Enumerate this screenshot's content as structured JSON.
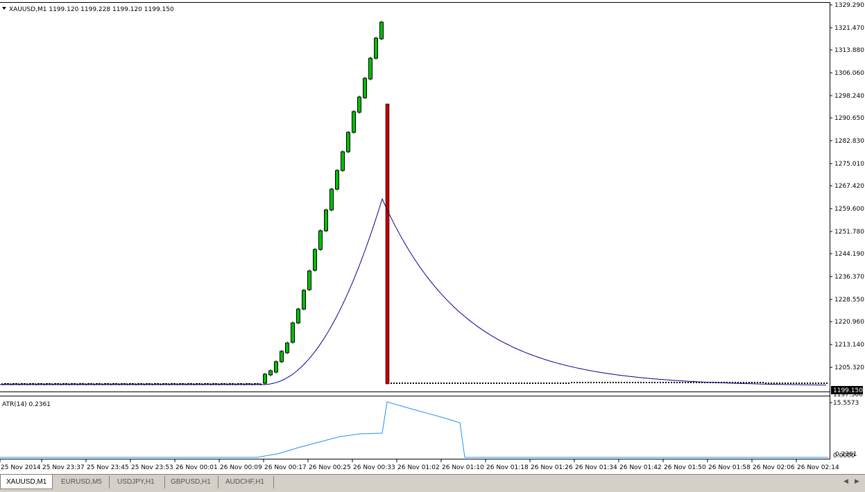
{
  "main_chart": {
    "symbol_title": "XAUUSD,M1  1199.120 1199.228 1199.120 1199.150",
    "current_price_label": "1199.150",
    "hidden_label": "1197.500",
    "price_ticks": [
      "1329.290",
      "1321.470",
      "1313.880",
      "1306.060",
      "1298.240",
      "1290.650",
      "1282.830",
      "1275.010",
      "1267.420",
      "1259.600",
      "1251.780",
      "1244.190",
      "1236.370",
      "1228.550",
      "1220.960",
      "1213.140",
      "1205.320"
    ],
    "colors": {
      "bull_candle": "#00c000",
      "bear_bar": "#c00000",
      "indicator_line": "#00008b",
      "atr_line": "#1e90ff"
    }
  },
  "indicator": {
    "title": "ATR(14) 0.2361",
    "ticks": [
      "15.5573",
      "0.0000",
      "0.2361"
    ]
  },
  "time_axis": {
    "labels": [
      "25 Nov 2014",
      "25 Nov 23:37",
      "25 Nov 23:45",
      "25 Nov 23:53",
      "26 Nov 00:01",
      "26 Nov 00:09",
      "26 Nov 00:17",
      "26 Nov 00:25",
      "26 Nov 00:33",
      "26 Nov 01:02",
      "26 Nov 01:10",
      "26 Nov 01:18",
      "26 Nov 01:26",
      "26 Nov 01:34",
      "26 Nov 01:42",
      "26 Nov 01:50",
      "26 Nov 01:58",
      "26 Nov 02:06",
      "26 Nov 02:14"
    ]
  },
  "tabs": [
    {
      "label": "XAUUSD,M1",
      "active": true
    },
    {
      "label": "EURUSD,M5",
      "active": false
    },
    {
      "label": "USDJPY,H1",
      "active": false
    },
    {
      "label": "GBPUSD,H1",
      "active": false
    },
    {
      "label": "AUDCHF,H1",
      "active": false
    }
  ],
  "icons": {
    "collapse": "triangle-down-icon",
    "scroll_left": "arrow-left-icon",
    "scroll_right": "arrow-right-icon"
  }
}
